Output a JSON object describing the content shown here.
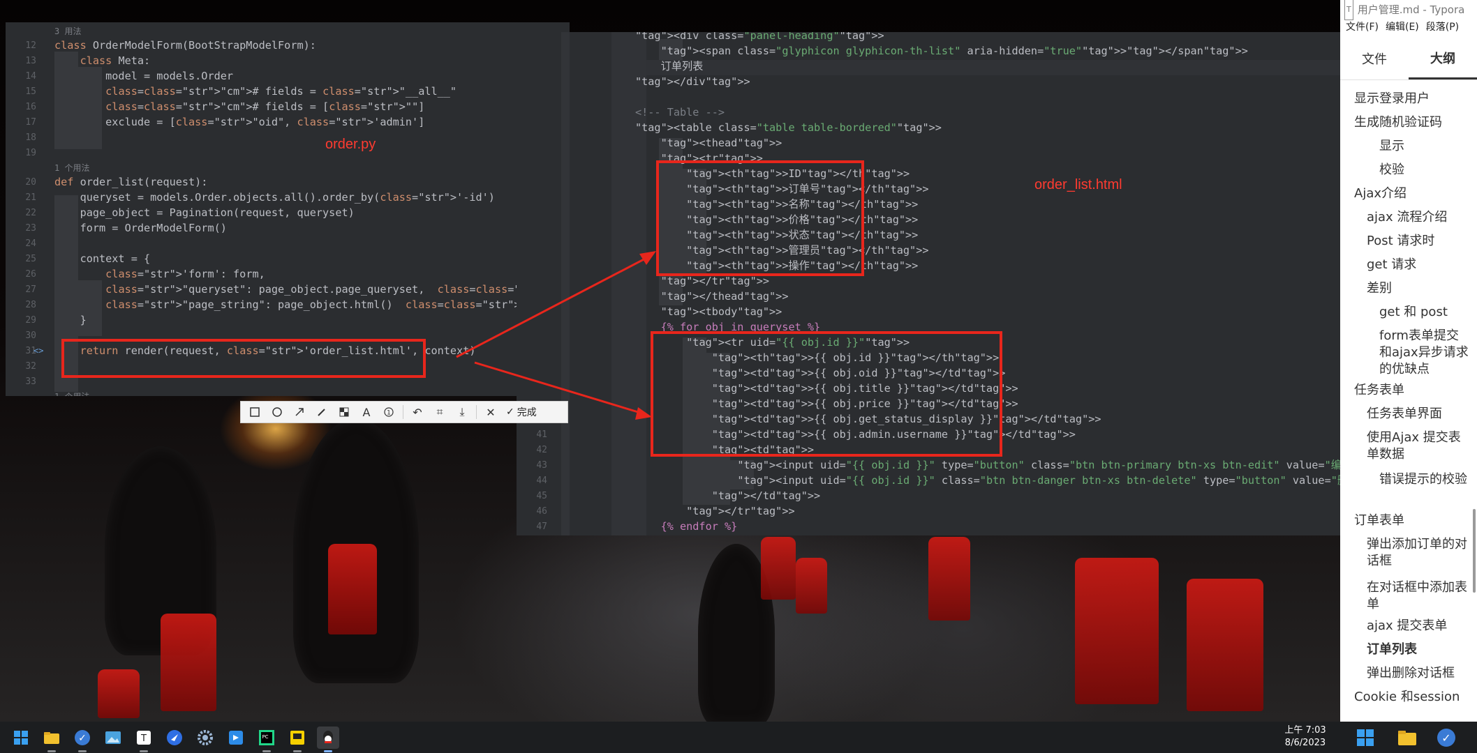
{
  "left_editor": {
    "file_label": "order.py",
    "lines": [
      {
        "hint": "3 用法"
      },
      {
        "num": "12",
        "code": "class OrderModelForm(BootStrapModelForm):"
      },
      {
        "num": "13",
        "code": "    class Meta:"
      },
      {
        "num": "14",
        "code": "        model = models.Order"
      },
      {
        "num": "15",
        "code": "        # fields = \"__all__\""
      },
      {
        "num": "16",
        "code": "        # fields = [\"\"]"
      },
      {
        "num": "17",
        "code": "        exclude = [\"oid\", 'admin']"
      },
      {
        "num": "18",
        "code": ""
      },
      {
        "num": "19",
        "code": ""
      },
      {
        "hint": "1 个用法"
      },
      {
        "num": "20",
        "code": "def order_list(request):"
      },
      {
        "num": "21",
        "code": "    queryset = models.Order.objects.all().order_by('-id')"
      },
      {
        "num": "22",
        "code": "    page_object = Pagination(request, queryset)"
      },
      {
        "num": "23",
        "code": "    form = OrderModelForm()"
      },
      {
        "num": "24",
        "code": ""
      },
      {
        "num": "25",
        "code": "    context = {"
      },
      {
        "num": "26",
        "code": "        'form': form,"
      },
      {
        "num": "27",
        "code": "        \"queryset\": page_object.page_queryset,  # 分完页的数据"
      },
      {
        "num": "28",
        "code": "        \"page_string\": page_object.html()  # 生成页码"
      },
      {
        "num": "29",
        "code": "    }"
      },
      {
        "num": "30",
        "code": ""
      },
      {
        "num": "31",
        "code": "    return render(request, 'order_list.html', context)",
        "marker": "<>"
      },
      {
        "num": "32",
        "code": ""
      },
      {
        "num": "33",
        "code": ""
      },
      {
        "hint": "1 个用法"
      }
    ]
  },
  "right_editor": {
    "file_label": "order_list.html",
    "lines": [
      {
        "num": "",
        "code": "<div class=\"panel-heading\">"
      },
      {
        "num": "",
        "code": "    <span class=\"glyphicon glyphicon-th-list\" aria-hidden=\"true\"></span>"
      },
      {
        "num": "",
        "code": "    订单列表"
      },
      {
        "num": "",
        "code": "</div>"
      },
      {
        "num": "",
        "code": ""
      },
      {
        "num": "",
        "code": "<!-- Table -->"
      },
      {
        "num": "",
        "code": "<table class=\"table table-bordered\">"
      },
      {
        "num": "",
        "code": "    <thead>"
      },
      {
        "num": "",
        "code": "    <tr>"
      },
      {
        "num": "",
        "code": "        <th>ID</th>"
      },
      {
        "num": "",
        "code": "        <th>订单号</th>"
      },
      {
        "num": "",
        "code": "        <th>名称</th>"
      },
      {
        "num": "",
        "code": "        <th>价格</th>"
      },
      {
        "num": "",
        "code": "        <th>状态</th>"
      },
      {
        "num": "",
        "code": "        <th>管理员</th>"
      },
      {
        "num": "",
        "code": "        <th>操作</th>"
      },
      {
        "num": "",
        "code": "    </tr>"
      },
      {
        "num": "",
        "code": "    </thead>"
      },
      {
        "num": "",
        "code": "    <tbody>"
      },
      {
        "num": "",
        "code": "    {% for obj in queryset %}"
      },
      {
        "num": "",
        "code": "        <tr uid=\"{{ obj.id }}\">"
      },
      {
        "num": "",
        "code": "            <th>{{ obj.id }}</th>"
      },
      {
        "num": "",
        "code": "            <td>{{ obj.oid }}</td>"
      },
      {
        "num": "",
        "code": "            <td>{{ obj.title }}</td>"
      },
      {
        "num": "",
        "code": "            <td>{{ obj.price }}</td>"
      },
      {
        "num": "",
        "code": "            <td>{{ obj.get_status_display }}</td>"
      },
      {
        "num": "41",
        "code": "            <td>{{ obj.admin.username }}</td>"
      },
      {
        "num": "42",
        "code": "            <td>"
      },
      {
        "num": "43",
        "code": "                <input uid=\"{{ obj.id }}\" type=\"button\" class=\"btn btn-primary btn-xs btn-edit\" value=\"编辑\">"
      },
      {
        "num": "44",
        "code": "                <input uid=\"{{ obj.id }}\" class=\"btn btn-danger btn-xs btn-delete\" type=\"button\" value=\"删除\">"
      },
      {
        "num": "45",
        "code": "            </td>"
      },
      {
        "num": "46",
        "code": "        </tr>"
      },
      {
        "num": "47",
        "code": "    {% endfor %}"
      }
    ]
  },
  "capture_toolbar": {
    "tools": [
      "rectangle-icon",
      "ellipse-icon",
      "arrow-icon",
      "pen-icon",
      "mosaic-icon",
      "text-icon",
      "number-icon",
      "undo-icon",
      "pin-icon",
      "download-icon",
      "close-icon"
    ],
    "done_label": "完成"
  },
  "typora": {
    "title": "用户管理.md - Typora",
    "menu": [
      "文件(F)",
      "编辑(E)",
      "段落(P)"
    ],
    "tabs": {
      "files": "文件",
      "outline": "大纲"
    },
    "outline": [
      {
        "text": "显示登录用户",
        "level": 1
      },
      {
        "text": "生成随机验证码",
        "level": 1
      },
      {
        "text": "显示",
        "level": 2
      },
      {
        "text": "校验",
        "level": 2
      },
      {
        "text": "Ajax介绍",
        "level": 0
      },
      {
        "text": "ajax 流程介绍",
        "level": 1
      },
      {
        "text": "Post 请求时",
        "level": 1
      },
      {
        "text": "get 请求",
        "level": 1
      },
      {
        "text": "差别",
        "level": 1
      },
      {
        "text": "get 和 post",
        "level": 2
      },
      {
        "text": "form表单提交和ajax异步请求的优缺点",
        "level": 2
      },
      {
        "text": "任务表单",
        "level": 0
      },
      {
        "text": "任务表单界面",
        "level": 1
      },
      {
        "text": "使用Ajax 提交表单数据",
        "level": 1
      },
      {
        "text": "错误提示的校验",
        "level": 2
      },
      {
        "text": "订单表单",
        "level": 0
      },
      {
        "text": "弹出添加订单的对话框",
        "level": 1
      },
      {
        "text": "在对话框中添加表单",
        "level": 1
      },
      {
        "text": "ajax 提交表单",
        "level": 1
      },
      {
        "text": "订单列表",
        "level": 1,
        "bold": true
      },
      {
        "text": "弹出删除对话框",
        "level": 1
      },
      {
        "text": "Cookie 和session",
        "level": 0
      }
    ]
  },
  "taskbar": {
    "apps": [
      "windows-start-icon",
      "file-explorer-icon",
      "typora-icon",
      "photos-icon",
      "typora-app-icon",
      "feishu-icon",
      "settings-icon",
      "vscode-icon",
      "pycharm-icon",
      "flipper-icon",
      "qq-icon"
    ],
    "time": "上午 7:03",
    "date": "8/6/2023"
  }
}
